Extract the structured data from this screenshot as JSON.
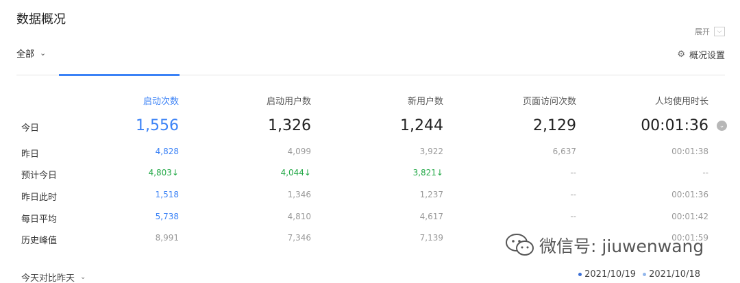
{
  "header": {
    "title": "数据概况",
    "expand_label": "展开",
    "filter_label": "全部",
    "settings_label": "概况设置"
  },
  "columns": [
    "启动次数",
    "启动用户数",
    "新用户数",
    "页面访问次数",
    "人均使用时长"
  ],
  "rows": [
    {
      "label": "今日",
      "values": [
        "1,556",
        "1,326",
        "1,244",
        "2,129",
        "00:01:36"
      ]
    },
    {
      "label": "昨日",
      "values": [
        "4,828",
        "4,099",
        "3,922",
        "6,637",
        "00:01:38"
      ]
    },
    {
      "label": "预计今日",
      "values": [
        "4,803↓",
        "4,044↓",
        "3,821↓",
        "--",
        "--"
      ]
    },
    {
      "label": "昨日此时",
      "values": [
        "1,518",
        "1,346",
        "1,237",
        "--",
        "00:01:36"
      ]
    },
    {
      "label": "每日平均",
      "values": [
        "5,738",
        "4,810",
        "4,617",
        "--",
        "00:01:42"
      ]
    },
    {
      "label": "历史峰值",
      "values": [
        "8,991",
        "7,346",
        "7,139",
        "",
        "00:01:59"
      ]
    }
  ],
  "footer": {
    "compare_label": "今天对比昨天",
    "legend": [
      {
        "label": "2021/10/19",
        "color": "#3b6fd6"
      },
      {
        "label": "2021/10/18",
        "color": "#93b7ec"
      }
    ]
  },
  "watermark": {
    "text": "微信号: jiuwenwang"
  },
  "colors": {
    "accent": "#3b82f6",
    "down": "#22a846"
  }
}
